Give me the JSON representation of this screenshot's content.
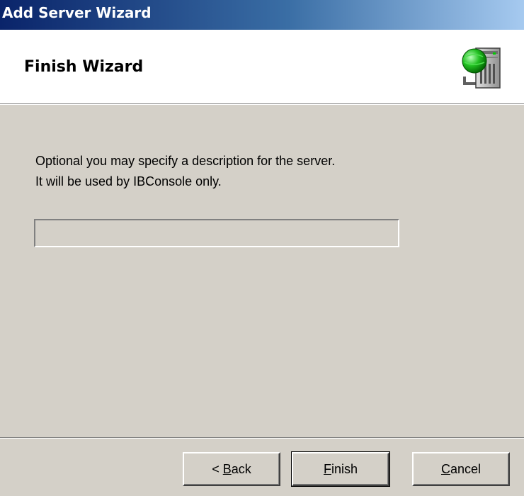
{
  "window": {
    "title": "Add Server Wizard"
  },
  "header": {
    "heading": "Finish Wizard",
    "icon": "server-network-icon"
  },
  "main": {
    "description_line1": "Optional you may specify a description for the server.",
    "description_line2": "It will be used by IBConsole only.",
    "description_field": {
      "value": "",
      "placeholder": ""
    }
  },
  "buttons": {
    "back": {
      "prefix": "< ",
      "mnemonic": "B",
      "rest": "ack"
    },
    "finish": {
      "prefix": "",
      "mnemonic": "F",
      "rest": "inish"
    },
    "cancel": {
      "prefix": "",
      "mnemonic": "C",
      "rest": "ancel"
    }
  },
  "colors": {
    "face": "#d4d0c8",
    "titlebar_start": "#0a246a",
    "titlebar_end": "#a6caf0"
  }
}
